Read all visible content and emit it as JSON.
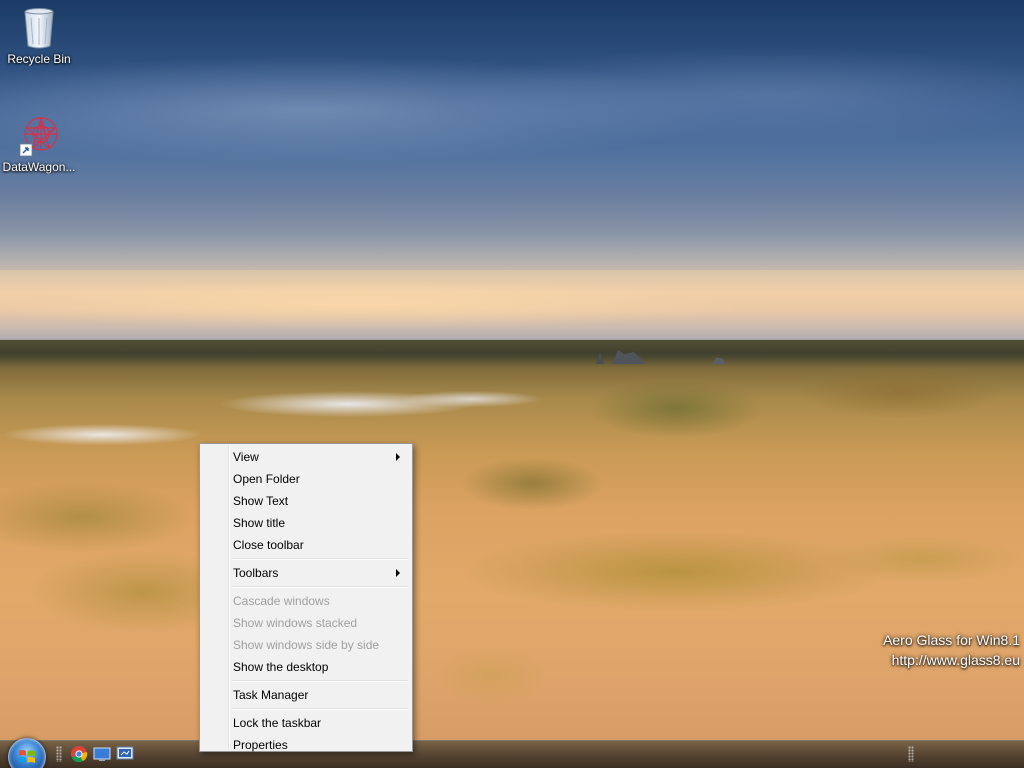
{
  "desktop": {
    "icons": [
      {
        "label": "Recycle Bin",
        "icon": "recycle-bin-icon"
      },
      {
        "label": "DataWagon...",
        "icon": "datawagon-icon"
      }
    ],
    "watermark": {
      "line1": "Aero Glass for Win8.1",
      "line2": "http://www.glass8.eu"
    }
  },
  "context_menu": {
    "items": [
      {
        "label": "View",
        "submenu": true,
        "enabled": true
      },
      {
        "label": "Open Folder",
        "enabled": true
      },
      {
        "label": "Show Text",
        "enabled": true
      },
      {
        "label": "Show title",
        "enabled": true
      },
      {
        "label": "Close toolbar",
        "enabled": true
      },
      {
        "label": "Toolbars",
        "submenu": true,
        "enabled": true
      },
      {
        "label": "Cascade windows",
        "enabled": false
      },
      {
        "label": "Show windows stacked",
        "enabled": false
      },
      {
        "label": "Show windows side by side",
        "enabled": false
      },
      {
        "label": "Show the desktop",
        "enabled": true
      },
      {
        "label": "Task Manager",
        "enabled": true
      },
      {
        "label": "Lock the taskbar",
        "enabled": true
      },
      {
        "label": "Properties",
        "enabled": true
      }
    ]
  },
  "taskbar": {
    "pinned": [
      {
        "icon": "chrome-icon"
      },
      {
        "icon": "desktop-show-icon"
      },
      {
        "icon": "remote-desktop-icon"
      }
    ]
  },
  "colors": {
    "menu_bg": "#f1f1f1",
    "menu_border": "#979797",
    "disabled_text": "#a0a0a0",
    "start_orb": "#3b85d2"
  }
}
